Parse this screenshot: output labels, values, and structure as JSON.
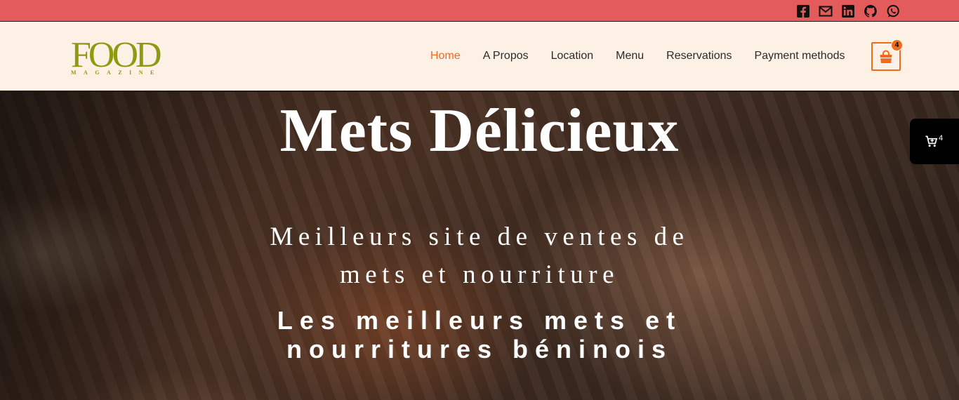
{
  "social": [
    {
      "name": "facebook-icon"
    },
    {
      "name": "mail-icon"
    },
    {
      "name": "linkedin-icon"
    },
    {
      "name": "github-icon"
    },
    {
      "name": "whatsapp-icon"
    }
  ],
  "logo": {
    "word": "FOOD",
    "sub": "MAGAZINE"
  },
  "nav": {
    "items": [
      "Home",
      "A Propos",
      "Location",
      "Menu",
      "Reservations",
      "Payment methods"
    ],
    "active": "Home"
  },
  "cart": {
    "count": "4",
    "icon": "shopping-bag-icon"
  },
  "hero": {
    "title": "Mets Délicieux",
    "subtitle": "Meilleurs site de ventes de mets et nourriture",
    "tagline": "Les meilleurs mets et nourritures béninois"
  },
  "float_cart": {
    "count": "4",
    "icon": "cart-icon"
  },
  "colors": {
    "topbar": "#e35b5b",
    "header_bg": "#fdf1e5",
    "accent": "#f06b1d",
    "logo": "#8f9a12"
  }
}
